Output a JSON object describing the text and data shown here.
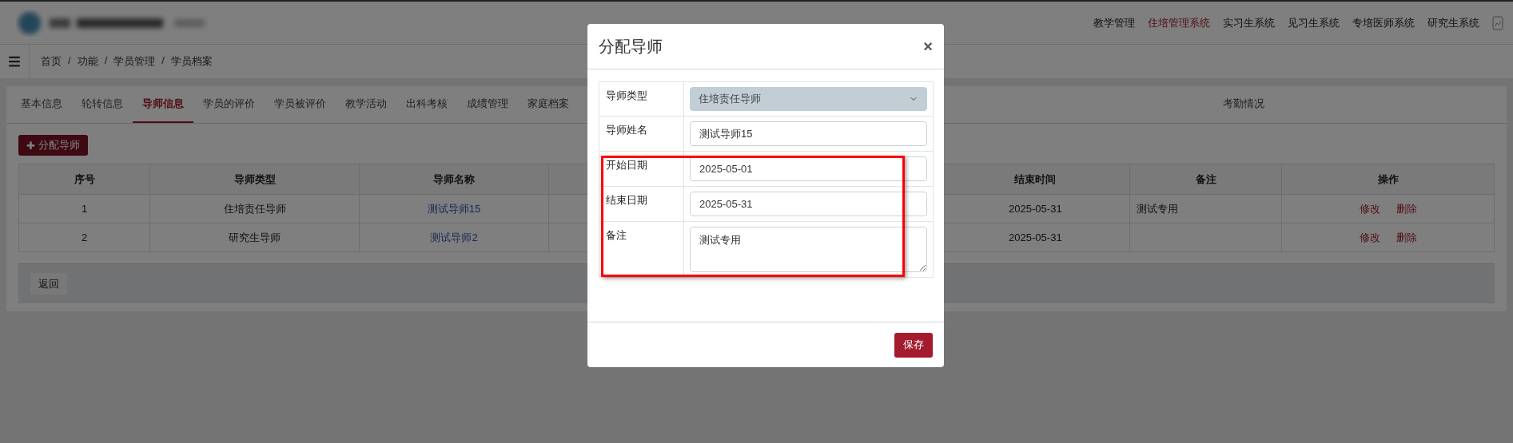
{
  "header": {
    "systems": [
      {
        "label": "教学管理",
        "selected": false
      },
      {
        "label": "住培管理系统",
        "selected": true
      },
      {
        "label": "实习生系统",
        "selected": false
      },
      {
        "label": "见习生系统",
        "selected": false
      },
      {
        "label": "专培医师系统",
        "selected": false
      },
      {
        "label": "研究生系统",
        "selected": false
      }
    ]
  },
  "breadcrumb": {
    "separator": "/",
    "items": [
      "首页",
      "功能",
      "学员管理",
      "学员档案"
    ]
  },
  "tabs": [
    {
      "label": "基本信息",
      "selected": false
    },
    {
      "label": "轮转信息",
      "selected": false
    },
    {
      "label": "导师信息",
      "selected": true
    },
    {
      "label": "学员的评价",
      "selected": false
    },
    {
      "label": "学员被评价",
      "selected": false
    },
    {
      "label": "教学活动",
      "selected": false
    },
    {
      "label": "出科考核",
      "selected": false
    },
    {
      "label": "成绩管理",
      "selected": false
    },
    {
      "label": "家庭档案",
      "selected": false
    }
  ],
  "tabs_right": [
    {
      "label": "考勤情况",
      "selected": false
    }
  ],
  "add_button": {
    "icon": "✚",
    "label": "分配导师"
  },
  "table": {
    "columns": [
      "序号",
      "导师类型",
      "导师名称",
      "结束时间",
      "备注",
      "操作"
    ],
    "rows": [
      {
        "cells": [
          "1",
          "住培责任导师",
          "测试导师15",
          "2025-05-31",
          "测试专用"
        ],
        "actions": [
          "修改",
          "删除"
        ]
      },
      {
        "cells": [
          "2",
          "研究生导师",
          "测试导师2",
          "2025-05-31",
          null
        ],
        "actions": [
          "修改",
          "删除"
        ]
      }
    ]
  },
  "back_button": "返回",
  "modal": {
    "title": "分配导师",
    "close": "×",
    "fields": [
      {
        "kind": "select",
        "label": "导师类型",
        "value": "住培责任导师",
        "disabled": true
      },
      {
        "kind": "text",
        "label": "导师姓名",
        "value": "测试导师15",
        "disabled": false
      },
      {
        "kind": "text",
        "label": "开始日期",
        "value": "2025-05-01",
        "disabled": false
      },
      {
        "kind": "text",
        "label": "结束日期",
        "value": "2025-05-31",
        "disabled": false
      },
      {
        "kind": "textarea",
        "label": "备注",
        "value": "测试专用",
        "disabled": false
      }
    ],
    "save_button": "保存"
  }
}
